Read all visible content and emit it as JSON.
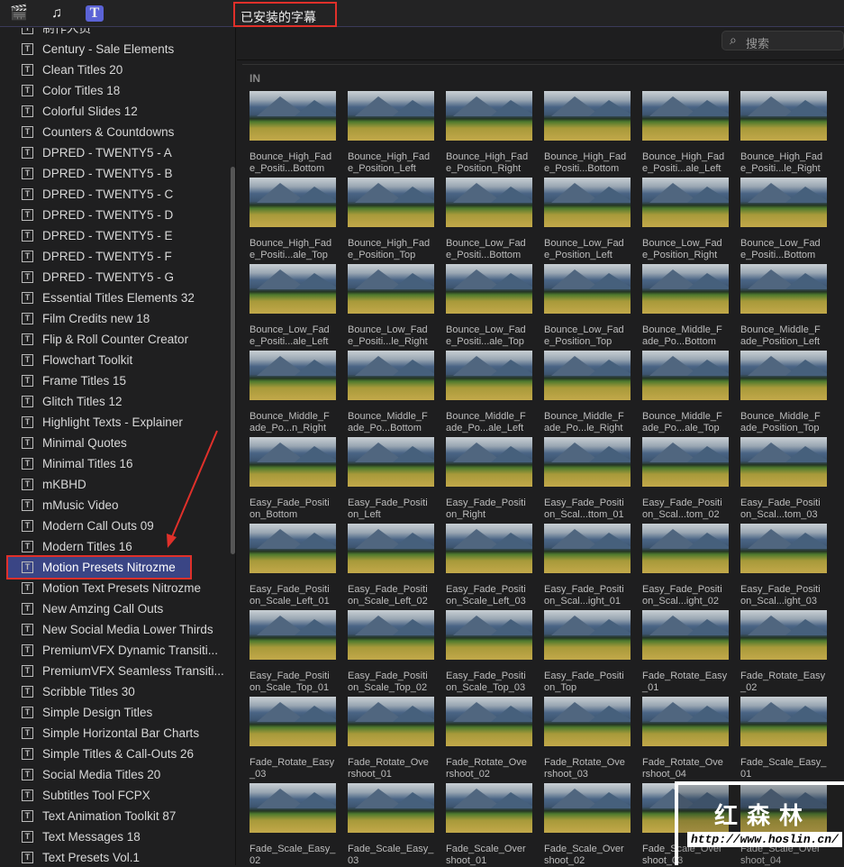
{
  "toolbar": {
    "icons": [
      "clapper-star-icon",
      "music-photo-icon",
      "titles-icon"
    ],
    "library_select": "已安装的字幕 ⌃⌄",
    "library_label": "已安装的字幕"
  },
  "sidebar": {
    "items": [
      "制作人员",
      "Century - Sale Elements",
      "Clean Titles 20",
      "Color Titles 18",
      "Colorful Slides 12",
      "Counters & Countdowns",
      "DPRED - TWENTY5 - A",
      "DPRED - TWENTY5 - B",
      "DPRED - TWENTY5 - C",
      "DPRED - TWENTY5 - D",
      "DPRED - TWENTY5 - E",
      "DPRED - TWENTY5 - F",
      "DPRED - TWENTY5 - G",
      "Essential Titles Elements 32",
      "Film Credits new 18",
      "Flip & Roll Counter Creator",
      "Flowchart Toolkit",
      "Frame Titles 15",
      "Glitch Titles 12",
      "Highlight Texts - Explainer",
      "Minimal Quotes",
      "Minimal Titles 16",
      "mKBHD",
      "mMusic Video",
      "Modern Call Outs 09",
      "Modern Titles 16",
      "Motion Presets Nitrozme",
      "Motion Text Presets Nitrozme",
      "New Amzing Call Outs",
      "New Social Media Lower Thirds",
      "PremiumVFX Dynamic Transiti...",
      "PremiumVFX Seamless Transiti...",
      "Scribble Titles 30",
      "Simple Design Titles",
      "Simple Horizontal Bar Charts",
      "Simple Titles & Call-Outs 26",
      "Social Media Titles 20",
      "Subtitles Tool FCPX",
      "Text Animation Toolkit 87",
      "Text Messages 18",
      "Text Presets Vol.1"
    ],
    "selected_index": 26
  },
  "search": {
    "placeholder": "搜索"
  },
  "section_label": "IN",
  "clips": [
    [
      "Bounce_High_Fad",
      "e_Positi...Bottom"
    ],
    [
      "Bounce_High_Fad",
      "e_Position_Left"
    ],
    [
      "Bounce_High_Fad",
      "e_Position_Right"
    ],
    [
      "Bounce_High_Fad",
      "e_Positi...Bottom"
    ],
    [
      "Bounce_High_Fad",
      "e_Positi...ale_Left"
    ],
    [
      "Bounce_High_Fad",
      "e_Positi...le_Right"
    ],
    [
      "Bounce_High_Fad",
      "e_Positi...ale_Top"
    ],
    [
      "Bounce_High_Fad",
      "e_Position_Top"
    ],
    [
      "Bounce_Low_Fad",
      "e_Positi...Bottom"
    ],
    [
      "Bounce_Low_Fad",
      "e_Position_Left"
    ],
    [
      "Bounce_Low_Fad",
      "e_Position_Right"
    ],
    [
      "Bounce_Low_Fad",
      "e_Positi...Bottom"
    ],
    [
      "Bounce_Low_Fad",
      "e_Positi...ale_Left"
    ],
    [
      "Bounce_Low_Fad",
      "e_Positi...le_Right"
    ],
    [
      "Bounce_Low_Fad",
      "e_Positi...ale_Top"
    ],
    [
      "Bounce_Low_Fad",
      "e_Position_Top"
    ],
    [
      "Bounce_Middle_F",
      "ade_Po...Bottom"
    ],
    [
      "Bounce_Middle_F",
      "ade_Position_Left"
    ],
    [
      "Bounce_Middle_F",
      "ade_Po...n_Right"
    ],
    [
      "Bounce_Middle_F",
      "ade_Po...Bottom"
    ],
    [
      "Bounce_Middle_F",
      "ade_Po...ale_Left"
    ],
    [
      "Bounce_Middle_F",
      "ade_Po...le_Right"
    ],
    [
      "Bounce_Middle_F",
      "ade_Po...ale_Top"
    ],
    [
      "Bounce_Middle_F",
      "ade_Position_Top"
    ],
    [
      "Easy_Fade_Positi",
      "on_Bottom"
    ],
    [
      "Easy_Fade_Positi",
      "on_Left"
    ],
    [
      "Easy_Fade_Positi",
      "on_Right"
    ],
    [
      "Easy_Fade_Positi",
      "on_Scal...ttom_01"
    ],
    [
      "Easy_Fade_Positi",
      "on_Scal...tom_02"
    ],
    [
      "Easy_Fade_Positi",
      "on_Scal...tom_03"
    ],
    [
      "Easy_Fade_Positi",
      "on_Scale_Left_01"
    ],
    [
      "Easy_Fade_Positi",
      "on_Scale_Left_02"
    ],
    [
      "Easy_Fade_Positi",
      "on_Scale_Left_03"
    ],
    [
      "Easy_Fade_Positi",
      "on_Scal...ight_01"
    ],
    [
      "Easy_Fade_Positi",
      "on_Scal...ight_02"
    ],
    [
      "Easy_Fade_Positi",
      "on_Scal...ight_03"
    ],
    [
      "Easy_Fade_Positi",
      "on_Scale_Top_01"
    ],
    [
      "Easy_Fade_Positi",
      "on_Scale_Top_02"
    ],
    [
      "Easy_Fade_Positi",
      "on_Scale_Top_03"
    ],
    [
      "Easy_Fade_Positi",
      "on_Top"
    ],
    [
      "Fade_Rotate_Easy",
      "_01"
    ],
    [
      "Fade_Rotate_Easy",
      "_02"
    ],
    [
      "Fade_Rotate_Easy",
      "_03"
    ],
    [
      "Fade_Rotate_Ove",
      "rshoot_01"
    ],
    [
      "Fade_Rotate_Ove",
      "rshoot_02"
    ],
    [
      "Fade_Rotate_Ove",
      "rshoot_03"
    ],
    [
      "Fade_Rotate_Ove",
      "rshoot_04"
    ],
    [
      "Fade_Scale_Easy_",
      "01"
    ],
    [
      "Fade_Scale_Easy_",
      "02"
    ],
    [
      "Fade_Scale_Easy_",
      "03"
    ],
    [
      "Fade_Scale_Over",
      "shoot_01"
    ],
    [
      "Fade_Scale_Over",
      "shoot_02"
    ],
    [
      "Fade_Scale_Over",
      "shoot_03"
    ],
    [
      "Fade_Scale_Over",
      "shoot_04"
    ]
  ],
  "watermark": {
    "name": "红森林",
    "url": "http://www.hoslin.cn/"
  },
  "colors": {
    "selection": "#3a4585",
    "annotation": "#e0302a"
  }
}
